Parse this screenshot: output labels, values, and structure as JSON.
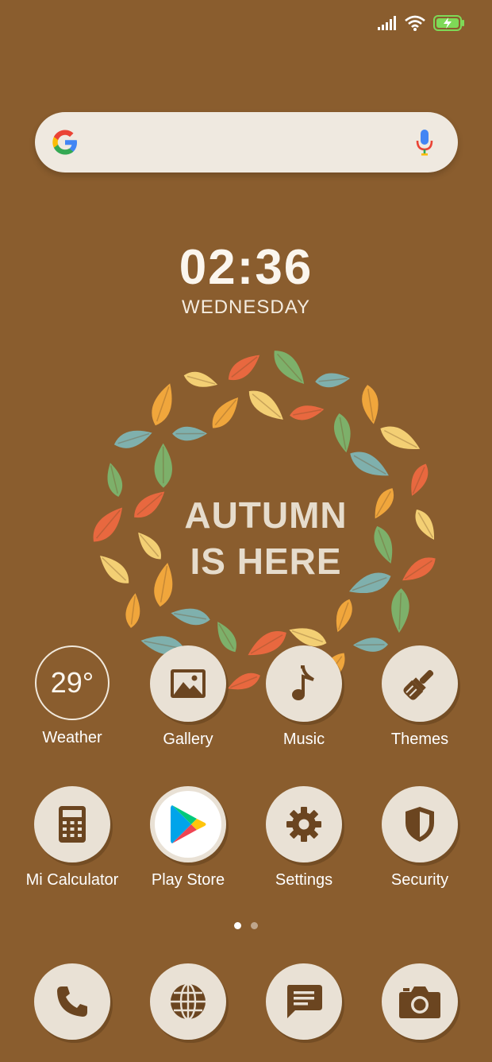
{
  "status_bar": {
    "icons": [
      "signal-icon",
      "wifi-icon",
      "battery-charging-icon"
    ],
    "battery_color": "#7ed957"
  },
  "search": {
    "placeholder": "",
    "icons": [
      "google-logo-icon",
      "microphone-icon"
    ]
  },
  "clock": {
    "time": "02:36",
    "day": "WEDNESDAY"
  },
  "wallpaper": {
    "line1": "AUTUMN",
    "line2": "IS HERE",
    "leaf_colors": [
      "#f3cf74",
      "#e8683f",
      "#7db06a",
      "#7fb0ad",
      "#f0a63c"
    ]
  },
  "apps": {
    "row1": [
      {
        "label": "Weather",
        "value": "29°",
        "icon": "weather-widget"
      },
      {
        "label": "Gallery",
        "icon": "image-icon"
      },
      {
        "label": "Music",
        "icon": "music-note-icon"
      },
      {
        "label": "Themes",
        "icon": "paintbrush-icon"
      }
    ],
    "row2": [
      {
        "label": "Mi Calculator",
        "icon": "calculator-icon"
      },
      {
        "label": "Play Store",
        "icon": "play-store-icon"
      },
      {
        "label": "Settings",
        "icon": "gear-icon"
      },
      {
        "label": "Security",
        "icon": "shield-icon"
      }
    ]
  },
  "pages": {
    "count": 2,
    "active": 1
  },
  "dock": [
    {
      "icon": "phone-icon"
    },
    {
      "icon": "globe-icon"
    },
    {
      "icon": "message-icon"
    },
    {
      "icon": "camera-icon"
    }
  ],
  "colors": {
    "background": "#8a5d2e",
    "icon_fill": "#e9e1d5",
    "glyph": "#6b4520"
  }
}
